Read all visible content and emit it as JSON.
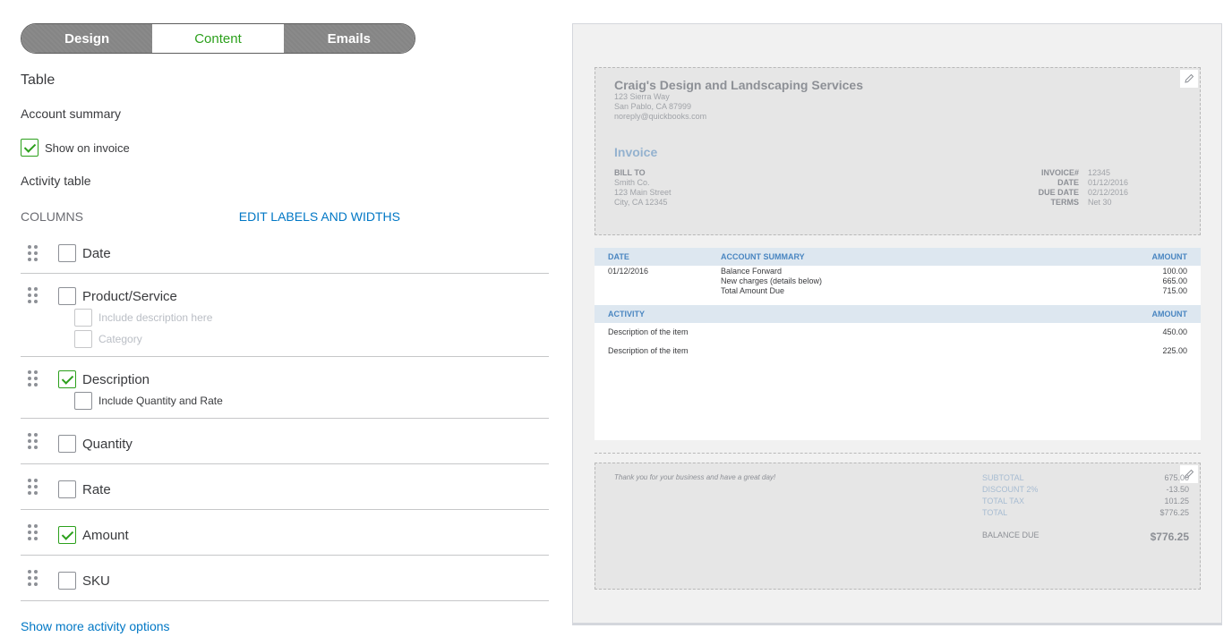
{
  "tabs": [
    {
      "label": "Design"
    },
    {
      "label": "Content"
    },
    {
      "label": "Emails"
    }
  ],
  "section_title": "Table",
  "account_summary": {
    "title": "Account summary",
    "show_label": "Show on invoice",
    "checked": true
  },
  "activity_title": "Activity table",
  "columns_label": "COLUMNS",
  "edit_link": "EDIT LABELS AND WIDTHS",
  "columns": [
    {
      "label": "Date",
      "checked": false
    },
    {
      "label": "Product/Service",
      "checked": false,
      "subs": [
        "Include description here",
        "Category"
      ]
    },
    {
      "label": "Description",
      "checked": true,
      "subs": [
        "Include Quantity and Rate"
      ]
    },
    {
      "label": "Quantity",
      "checked": false
    },
    {
      "label": "Rate",
      "checked": false
    },
    {
      "label": "Amount",
      "checked": true
    },
    {
      "label": "SKU",
      "checked": false
    }
  ],
  "more_link": "Show more activity options",
  "preview": {
    "company": "Craig's Design and Landscaping Services",
    "address": [
      "123 Sierra Way",
      "San Pablo, CA 87999",
      "noreply@quickbooks.com"
    ],
    "invoice_title": "Invoice",
    "bill_to_label": "BILL TO",
    "bill_to": [
      "Smith Co.",
      "123 Main Street",
      "City, CA 12345"
    ],
    "meta": [
      {
        "k": "INVOICE#",
        "v": "12345"
      },
      {
        "k": "DATE",
        "v": "01/12/2016"
      },
      {
        "k": "DUE DATE",
        "v": "02/12/2016"
      },
      {
        "k": "TERMS",
        "v": "Net 30"
      }
    ],
    "summary_headers": {
      "date": "DATE",
      "summary": "ACCOUNT SUMMARY",
      "amount": "AMOUNT"
    },
    "summary_date": "01/12/2016",
    "summary_rows": [
      {
        "label": "Balance Forward",
        "amount": "100.00"
      },
      {
        "label": "New charges (details below)",
        "amount": "665.00"
      },
      {
        "label": "Total Amount Due",
        "amount": "715.00"
      }
    ],
    "activity_headers": {
      "activity": "ACTIVITY",
      "amount": "AMOUNT"
    },
    "activity_rows": [
      {
        "label": "Description of the item",
        "amount": "450.00"
      },
      {
        "label": "Description of the item",
        "amount": "225.00"
      }
    ],
    "thanks": "Thank you for your business and have a great day!",
    "totals": [
      {
        "k": "SUBTOTAL",
        "v": "675.00"
      },
      {
        "k": "DISCOUNT 2%",
        "v": "-13.50"
      },
      {
        "k": "TOTAL TAX",
        "v": "101.25"
      },
      {
        "k": "TOTAL",
        "v": "$776.25"
      }
    ],
    "balance_label": "BALANCE DUE",
    "balance_value": "$776.25"
  }
}
